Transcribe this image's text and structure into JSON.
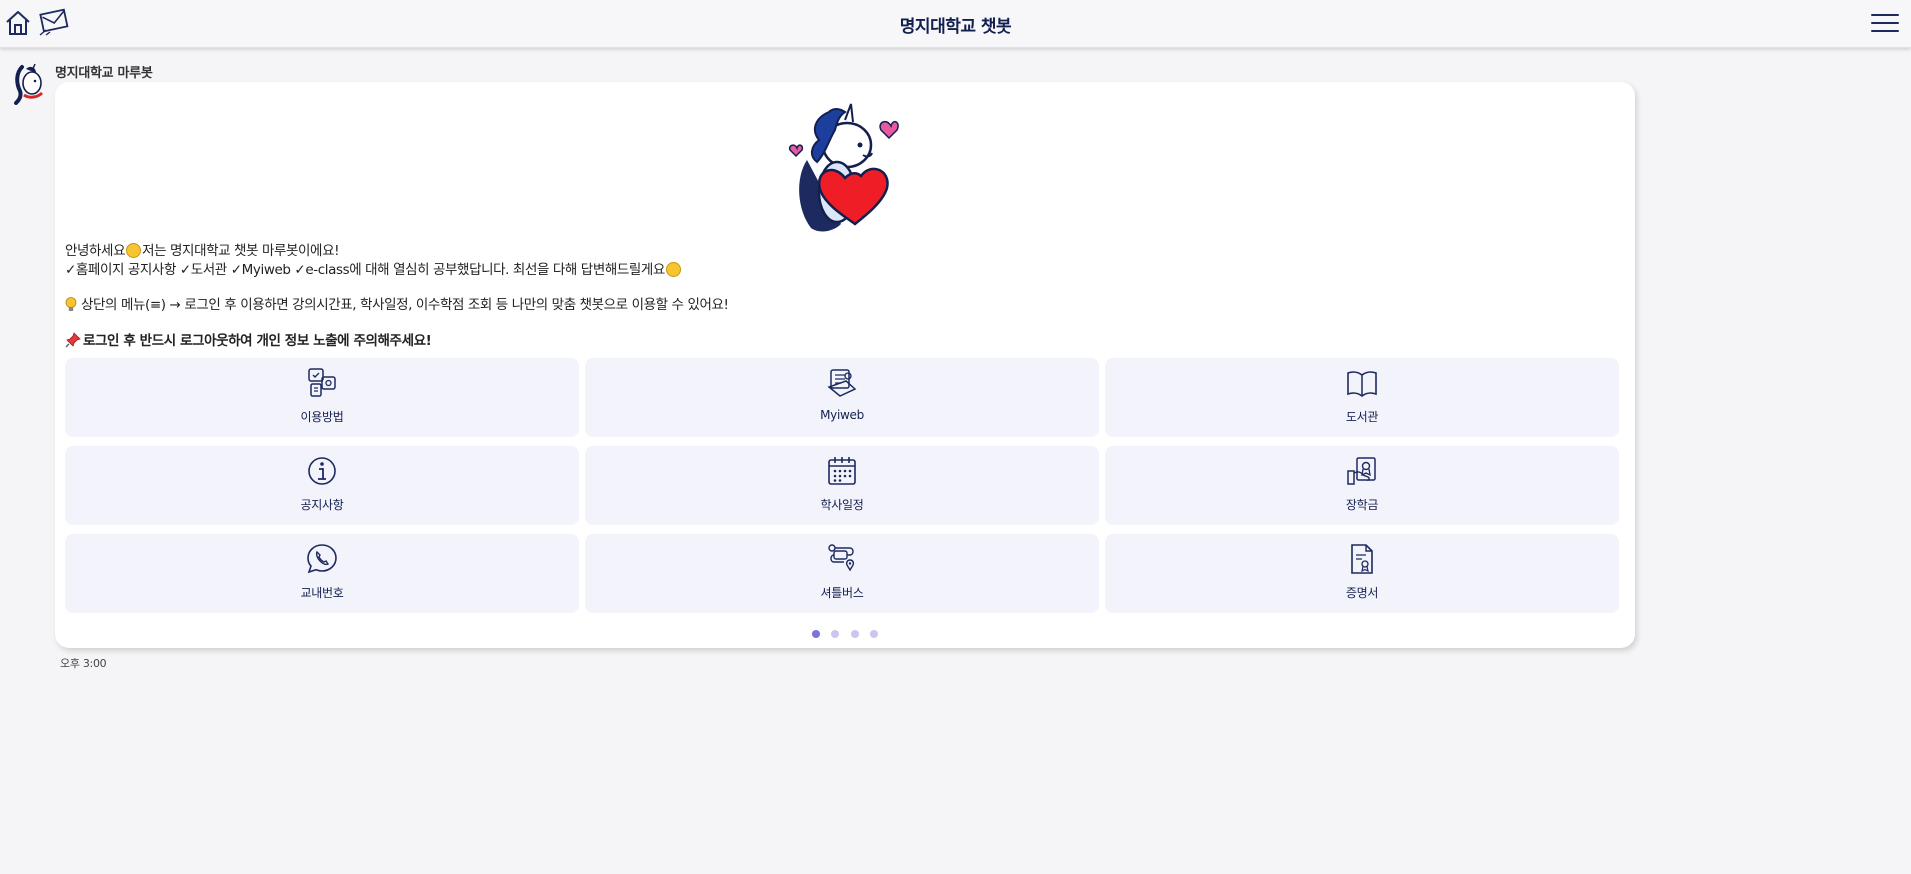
{
  "header": {
    "title": "명지대학교 챗봇",
    "home_icon": "home-icon",
    "mail_icon": "mail-icon",
    "menu_icon": "hamburger-menu-icon"
  },
  "bot": {
    "name": "명지대학교 마루봇",
    "avatar_icon": "unicorn-mascot-avatar"
  },
  "message": {
    "line1_a": "안녕하세요",
    "line1_b": "저는 명지대학교 챗봇 마루봇이에요!",
    "line2_a": "✓홈페이지 공지사항 ✓도서관 ✓Myiweb ✓e-class에 대해 열심히 공부했답니다. 최선을 다해 답변해드릴게요",
    "line3": "상단의 메뉴(≡) → 로그인 후 이용하면 강의시간표, 학사일정, 이수학점 조회 등 나만의 맞춤 챗봇으로 이용할 수 있어요!",
    "line4": "로그인 후 반드시 로그아웃하여 개인 정보 노출에 주의해주세요!"
  },
  "menu_tiles": [
    {
      "label": "이용방법",
      "icon": "guide-icon"
    },
    {
      "label": "Myiweb",
      "icon": "myiweb-icon"
    },
    {
      "label": "도서관",
      "icon": "book-icon"
    },
    {
      "label": "공지사항",
      "icon": "info-icon"
    },
    {
      "label": "학사일정",
      "icon": "calendar-icon"
    },
    {
      "label": "장학금",
      "icon": "scholarship-icon"
    },
    {
      "label": "교내번호",
      "icon": "phone-icon"
    },
    {
      "label": "셔틀버스",
      "icon": "bus-route-icon"
    },
    {
      "label": "증명서",
      "icon": "certificate-icon"
    }
  ],
  "pagination": {
    "total": 4,
    "current": 1
  },
  "timestamp": "오후 3:00",
  "colors": {
    "accent": "#13204f",
    "tile_bg": "#f3f3fb",
    "dot_active": "#7a72dd",
    "dot_inactive": "#c9c6f0"
  }
}
